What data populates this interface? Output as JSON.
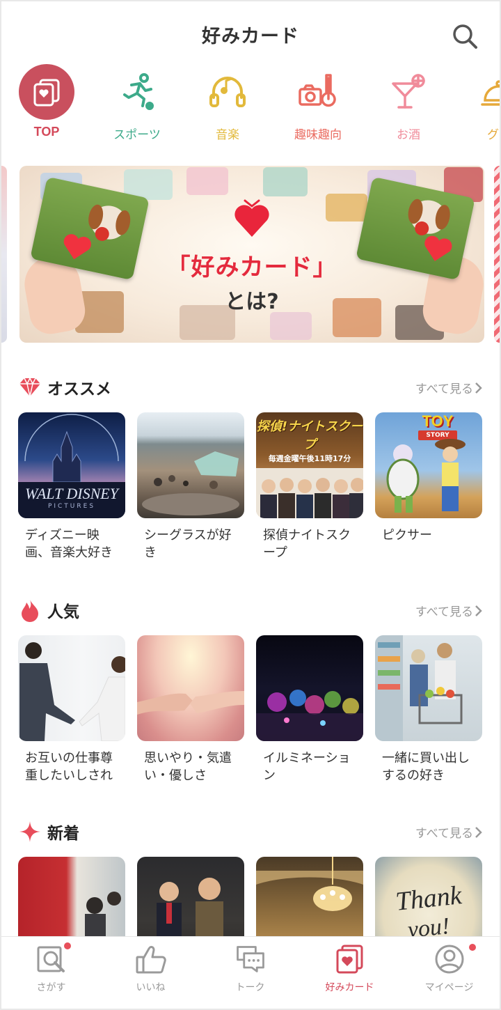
{
  "header": {
    "title": "好みカード"
  },
  "categories": [
    {
      "label": "TOP",
      "icon": "card-heart-icon",
      "color": "#d4495a",
      "active": true
    },
    {
      "label": "スポーツ",
      "icon": "runner-icon",
      "color": "#3daa8a"
    },
    {
      "label": "音楽",
      "icon": "headphones-icon",
      "color": "#e2b93b"
    },
    {
      "label": "趣味趣向",
      "icon": "guitar-camera-icon",
      "color": "#ea6b60"
    },
    {
      "label": "お酒",
      "icon": "cocktail-icon",
      "color": "#f08b9a"
    },
    {
      "label": "グル",
      "icon": "cloche-icon",
      "color": "#e6a93a"
    }
  ],
  "banner": {
    "title": "「好みカード」",
    "subtitle": "とは?"
  },
  "sections": {
    "recommended": {
      "title": "オススメ",
      "see_all": "すべて見る",
      "icon": "gem-icon",
      "items": [
        {
          "label": "ディズニー映画、音楽大好き",
          "thumb_text": "WALT DISNEY",
          "thumb_sub": "PICTURES"
        },
        {
          "label": "シーグラスが好き"
        },
        {
          "label": "探偵ナイトスクープ",
          "thumb_text": "探偵!ナイトスクープ",
          "thumb_sub": "毎週金曜午後11時17分"
        },
        {
          "label": "ピクサー",
          "thumb_text": "TOY",
          "thumb_sub": "STORY"
        }
      ]
    },
    "popular": {
      "title": "人気",
      "see_all": "すべて見る",
      "icon": "flame-icon",
      "items": [
        {
          "label": "お互いの仕事尊重したいしされ"
        },
        {
          "label": "思いやり・気遣い・優しさ"
        },
        {
          "label": "イルミネーション"
        },
        {
          "label": "一緒に買い出しするの好き"
        }
      ]
    },
    "new": {
      "title": "新着",
      "see_all": "すべて見る",
      "icon": "sparkle-icon",
      "items": [
        {
          "label": ""
        },
        {
          "label": ""
        },
        {
          "label": ""
        },
        {
          "label": "",
          "thumb_text": "Thank",
          "thumb_sub": "you!"
        }
      ]
    }
  },
  "bottom_nav": [
    {
      "label": "さがす",
      "icon": "search-card-icon",
      "badge": true
    },
    {
      "label": "いいね",
      "icon": "thumbs-up-icon",
      "badge": false
    },
    {
      "label": "トーク",
      "icon": "chat-icon",
      "badge": false
    },
    {
      "label": "好みカード",
      "icon": "card-heart-icon",
      "badge": false,
      "active": true
    },
    {
      "label": "マイページ",
      "icon": "profile-icon",
      "badge": true
    }
  ],
  "colors": {
    "accent": "#d4495a",
    "muted": "#999999",
    "badge": "#e8505b"
  }
}
